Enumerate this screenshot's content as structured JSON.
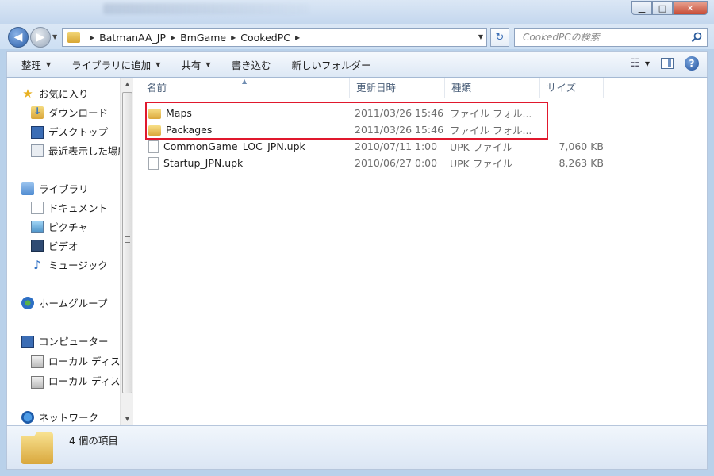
{
  "window": {
    "caption_minimize": "▁",
    "caption_maximize": "□",
    "caption_close": "✕"
  },
  "address": {
    "crumbs": [
      "BatmanAA_JP",
      "BmGame",
      "CookedPC"
    ]
  },
  "search": {
    "placeholder": "CookedPCの検索"
  },
  "commandbar": {
    "organize": "整理",
    "add_to_library": "ライブラリに追加",
    "share": "共有",
    "burn": "書き込む",
    "new_folder": "新しいフォルダー"
  },
  "navpane": {
    "favorites": "お気に入り",
    "downloads": "ダウンロード",
    "desktop": "デスクトップ",
    "recent": "最近表示した場所",
    "libraries": "ライブラリ",
    "documents": "ドキュメント",
    "pictures": "ピクチャ",
    "videos": "ビデオ",
    "music": "ミュージック",
    "homegroup": "ホームグループ",
    "computer": "コンピューター",
    "local_disk_1": "ローカル ディスク",
    "local_disk_2": "ローカル ディスク",
    "network": "ネットワーク"
  },
  "columns": {
    "name": "名前",
    "date": "更新日時",
    "type": "種類",
    "size": "サイズ"
  },
  "files": [
    {
      "name": "Maps",
      "date": "2011/03/26 15:46",
      "type": "ファイル フォル...",
      "size": "",
      "icon": "folder-icon"
    },
    {
      "name": "Packages",
      "date": "2011/03/26 15:46",
      "type": "ファイル フォル...",
      "size": "",
      "icon": "folder-icon"
    },
    {
      "name": "CommonGame_LOC_JPN.upk",
      "date": "2010/07/11 1:00",
      "type": "UPK ファイル",
      "size": "7,060 KB",
      "icon": "file-icon"
    },
    {
      "name": "Startup_JPN.upk",
      "date": "2010/06/27 0:00",
      "type": "UPK ファイル",
      "size": "8,263 KB",
      "icon": "file-icon"
    }
  ],
  "status": {
    "item_count": "4 個の項目"
  },
  "colors": {
    "highlight_border": "#e0182d",
    "window_frame": "#b9d1ea"
  }
}
